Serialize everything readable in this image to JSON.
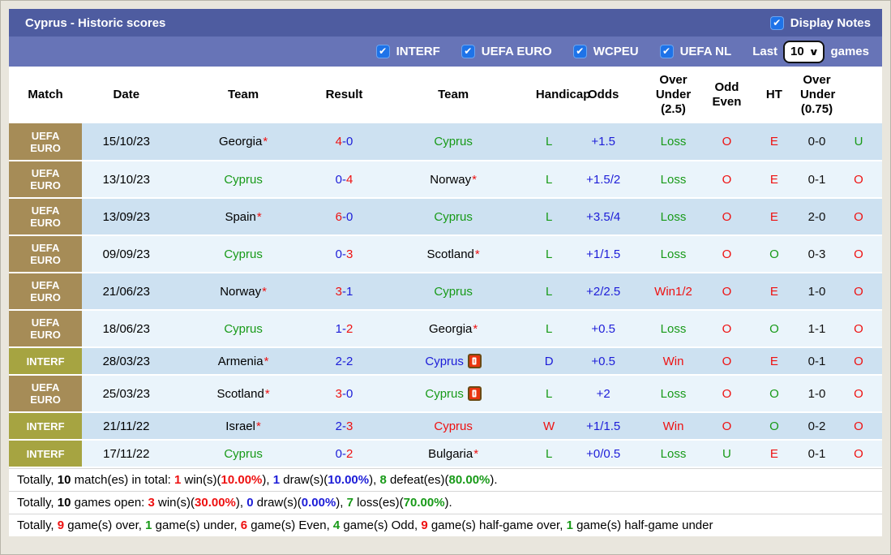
{
  "header": {
    "title": "Cyprus - Historic scores",
    "display_notes_label": "Display Notes"
  },
  "icons": {
    "check": "✔",
    "chevron_down": "∨"
  },
  "colors": {
    "title_bar": "#4e5ca0",
    "filter_bar": "#6774b7",
    "checkbox_blue": "#1e73e8",
    "euro_label_bg": "#a68c57",
    "interf_label_bg": "#a6a441",
    "row_dark": "#cde1f1",
    "row_light": "#eaf4fb",
    "win_red": "#ee1111",
    "draw_blue": "#1d1dd8",
    "loss_green": "#189a18"
  },
  "filters": {
    "competitions": [
      "INTERF",
      "UEFA EURO",
      "WCPEU",
      "UEFA NL"
    ],
    "last_label": "Last",
    "last_value": "10",
    "games_label": "games"
  },
  "table": {
    "columns": [
      "Match",
      "Date",
      "Team",
      "Result",
      "Team",
      "Handicap",
      "Odds",
      "Over Under (2.5)",
      "Odd Even",
      "HT",
      "Over Under (0.75)"
    ],
    "rows": [
      {
        "comp": {
          "label": "UEFA EURO",
          "class": "euro"
        },
        "date": "15/10/23",
        "home": {
          "name": "Georgia",
          "color": "black",
          "star": true,
          "redcard": false
        },
        "score": {
          "home": "4",
          "home_color": "red",
          "away": "0",
          "away_color": "blue"
        },
        "away": {
          "name": "Cyprus",
          "color": "green",
          "star": false,
          "redcard": false
        },
        "wdl": {
          "text": "L",
          "color": "green"
        },
        "handicap": "+1.5",
        "odds": {
          "text": "Loss",
          "color": "green"
        },
        "over_under_25": {
          "text": "O",
          "color": "red"
        },
        "odd_even": {
          "text": "E",
          "color": "red"
        },
        "ht": "0-0",
        "over_under_075": {
          "text": "U",
          "color": "green"
        }
      },
      {
        "comp": {
          "label": "UEFA EURO",
          "class": "euro"
        },
        "date": "13/10/23",
        "home": {
          "name": "Cyprus",
          "color": "green",
          "star": false,
          "redcard": false
        },
        "score": {
          "home": "0",
          "home_color": "blue",
          "away": "4",
          "away_color": "red"
        },
        "away": {
          "name": "Norway",
          "color": "black",
          "star": true,
          "redcard": false
        },
        "wdl": {
          "text": "L",
          "color": "green"
        },
        "handicap": "+1.5/2",
        "odds": {
          "text": "Loss",
          "color": "green"
        },
        "over_under_25": {
          "text": "O",
          "color": "red"
        },
        "odd_even": {
          "text": "E",
          "color": "red"
        },
        "ht": "0-1",
        "over_under_075": {
          "text": "O",
          "color": "red"
        }
      },
      {
        "comp": {
          "label": "UEFA EURO",
          "class": "euro"
        },
        "date": "13/09/23",
        "home": {
          "name": "Spain",
          "color": "black",
          "star": true,
          "redcard": false
        },
        "score": {
          "home": "6",
          "home_color": "red",
          "away": "0",
          "away_color": "blue"
        },
        "away": {
          "name": "Cyprus",
          "color": "green",
          "star": false,
          "redcard": false
        },
        "wdl": {
          "text": "L",
          "color": "green"
        },
        "handicap": "+3.5/4",
        "odds": {
          "text": "Loss",
          "color": "green"
        },
        "over_under_25": {
          "text": "O",
          "color": "red"
        },
        "odd_even": {
          "text": "E",
          "color": "red"
        },
        "ht": "2-0",
        "over_under_075": {
          "text": "O",
          "color": "red"
        }
      },
      {
        "comp": {
          "label": "UEFA EURO",
          "class": "euro"
        },
        "date": "09/09/23",
        "home": {
          "name": "Cyprus",
          "color": "green",
          "star": false,
          "redcard": false
        },
        "score": {
          "home": "0",
          "home_color": "blue",
          "away": "3",
          "away_color": "red"
        },
        "away": {
          "name": "Scotland",
          "color": "black",
          "star": true,
          "redcard": false
        },
        "wdl": {
          "text": "L",
          "color": "green"
        },
        "handicap": "+1/1.5",
        "odds": {
          "text": "Loss",
          "color": "green"
        },
        "over_under_25": {
          "text": "O",
          "color": "red"
        },
        "odd_even": {
          "text": "O",
          "color": "green"
        },
        "ht": "0-3",
        "over_under_075": {
          "text": "O",
          "color": "red"
        }
      },
      {
        "comp": {
          "label": "UEFA EURO",
          "class": "euro"
        },
        "date": "21/06/23",
        "home": {
          "name": "Norway",
          "color": "black",
          "star": true,
          "redcard": false
        },
        "score": {
          "home": "3",
          "home_color": "red",
          "away": "1",
          "away_color": "blue"
        },
        "away": {
          "name": "Cyprus",
          "color": "green",
          "star": false,
          "redcard": false
        },
        "wdl": {
          "text": "L",
          "color": "green"
        },
        "handicap": "+2/2.5",
        "odds": {
          "text": "Win1/2",
          "color": "red"
        },
        "over_under_25": {
          "text": "O",
          "color": "red"
        },
        "odd_even": {
          "text": "E",
          "color": "red"
        },
        "ht": "1-0",
        "over_under_075": {
          "text": "O",
          "color": "red"
        }
      },
      {
        "comp": {
          "label": "UEFA EURO",
          "class": "euro"
        },
        "date": "18/06/23",
        "home": {
          "name": "Cyprus",
          "color": "green",
          "star": false,
          "redcard": false
        },
        "score": {
          "home": "1",
          "home_color": "blue",
          "away": "2",
          "away_color": "red"
        },
        "away": {
          "name": "Georgia",
          "color": "black",
          "star": true,
          "redcard": false
        },
        "wdl": {
          "text": "L",
          "color": "green"
        },
        "handicap": "+0.5",
        "odds": {
          "text": "Loss",
          "color": "green"
        },
        "over_under_25": {
          "text": "O",
          "color": "red"
        },
        "odd_even": {
          "text": "O",
          "color": "green"
        },
        "ht": "1-1",
        "over_under_075": {
          "text": "O",
          "color": "red"
        }
      },
      {
        "comp": {
          "label": "INTERF",
          "class": "interf"
        },
        "date": "28/03/23",
        "home": {
          "name": "Armenia",
          "color": "black",
          "star": true,
          "redcard": false
        },
        "score": {
          "home": "2",
          "home_color": "blue",
          "away": "2",
          "away_color": "blue"
        },
        "away": {
          "name": "Cyprus",
          "color": "blue",
          "star": false,
          "redcard": true
        },
        "wdl": {
          "text": "D",
          "color": "blue"
        },
        "handicap": "+0.5",
        "odds": {
          "text": "Win",
          "color": "red"
        },
        "over_under_25": {
          "text": "O",
          "color": "red"
        },
        "odd_even": {
          "text": "E",
          "color": "red"
        },
        "ht": "0-1",
        "over_under_075": {
          "text": "O",
          "color": "red"
        }
      },
      {
        "comp": {
          "label": "UEFA EURO",
          "class": "euro"
        },
        "date": "25/03/23",
        "home": {
          "name": "Scotland",
          "color": "black",
          "star": true,
          "redcard": false
        },
        "score": {
          "home": "3",
          "home_color": "red",
          "away": "0",
          "away_color": "blue"
        },
        "away": {
          "name": "Cyprus",
          "color": "green",
          "star": false,
          "redcard": true
        },
        "wdl": {
          "text": "L",
          "color": "green"
        },
        "handicap": "+2",
        "odds": {
          "text": "Loss",
          "color": "green"
        },
        "over_under_25": {
          "text": "O",
          "color": "red"
        },
        "odd_even": {
          "text": "O",
          "color": "green"
        },
        "ht": "1-0",
        "over_under_075": {
          "text": "O",
          "color": "red"
        }
      },
      {
        "comp": {
          "label": "INTERF",
          "class": "interf"
        },
        "date": "21/11/22",
        "home": {
          "name": "Israel",
          "color": "black",
          "star": true,
          "redcard": false
        },
        "score": {
          "home": "2",
          "home_color": "blue",
          "away": "3",
          "away_color": "red"
        },
        "away": {
          "name": "Cyprus",
          "color": "red",
          "star": false,
          "redcard": false
        },
        "wdl": {
          "text": "W",
          "color": "red"
        },
        "handicap": "+1/1.5",
        "odds": {
          "text": "Win",
          "color": "red"
        },
        "over_under_25": {
          "text": "O",
          "color": "red"
        },
        "odd_even": {
          "text": "O",
          "color": "green"
        },
        "ht": "0-2",
        "over_under_075": {
          "text": "O",
          "color": "red"
        }
      },
      {
        "comp": {
          "label": "INTERF",
          "class": "interf"
        },
        "date": "17/11/22",
        "home": {
          "name": "Cyprus",
          "color": "green",
          "star": false,
          "redcard": false
        },
        "score": {
          "home": "0",
          "home_color": "blue",
          "away": "2",
          "away_color": "red"
        },
        "away": {
          "name": "Bulgaria",
          "color": "black",
          "star": true,
          "redcard": false
        },
        "wdl": {
          "text": "L",
          "color": "green"
        },
        "handicap": "+0/0.5",
        "odds": {
          "text": "Loss",
          "color": "green"
        },
        "over_under_25": {
          "text": "U",
          "color": "green"
        },
        "odd_even": {
          "text": "E",
          "color": "red"
        },
        "ht": "0-1",
        "over_under_075": {
          "text": "O",
          "color": "red"
        }
      }
    ]
  },
  "summary": [
    [
      {
        "text": "Totally, ",
        "style": "plain"
      },
      {
        "text": "10",
        "style": "bold"
      },
      {
        "text": " match(es) in total: ",
        "style": "plain"
      },
      {
        "text": "1",
        "style": "red"
      },
      {
        "text": " win(s)(",
        "style": "plain"
      },
      {
        "text": "10.00%",
        "style": "red"
      },
      {
        "text": "), ",
        "style": "plain"
      },
      {
        "text": "1",
        "style": "blue"
      },
      {
        "text": " draw(s)(",
        "style": "plain"
      },
      {
        "text": "10.00%",
        "style": "blue"
      },
      {
        "text": "), ",
        "style": "plain"
      },
      {
        "text": "8",
        "style": "green"
      },
      {
        "text": " defeat(es)(",
        "style": "plain"
      },
      {
        "text": "80.00%",
        "style": "green"
      },
      {
        "text": ").",
        "style": "plain"
      }
    ],
    [
      {
        "text": "Totally, ",
        "style": "plain"
      },
      {
        "text": "10",
        "style": "bold"
      },
      {
        "text": " games open: ",
        "style": "plain"
      },
      {
        "text": "3",
        "style": "red"
      },
      {
        "text": " win(s)(",
        "style": "plain"
      },
      {
        "text": "30.00%",
        "style": "red"
      },
      {
        "text": "), ",
        "style": "plain"
      },
      {
        "text": "0",
        "style": "blue"
      },
      {
        "text": " draw(s)(",
        "style": "plain"
      },
      {
        "text": "0.00%",
        "style": "blue"
      },
      {
        "text": "), ",
        "style": "plain"
      },
      {
        "text": "7",
        "style": "green"
      },
      {
        "text": " loss(es)(",
        "style": "plain"
      },
      {
        "text": "70.00%",
        "style": "green"
      },
      {
        "text": ").",
        "style": "plain"
      }
    ],
    [
      {
        "text": "Totally, ",
        "style": "plain"
      },
      {
        "text": "9",
        "style": "red"
      },
      {
        "text": " game(s) over, ",
        "style": "plain"
      },
      {
        "text": "1",
        "style": "green"
      },
      {
        "text": " game(s) under, ",
        "style": "plain"
      },
      {
        "text": "6",
        "style": "red"
      },
      {
        "text": " game(s) Even, ",
        "style": "plain"
      },
      {
        "text": "4",
        "style": "green"
      },
      {
        "text": " game(s) Odd, ",
        "style": "plain"
      },
      {
        "text": "9",
        "style": "red"
      },
      {
        "text": " game(s) half-game over, ",
        "style": "plain"
      },
      {
        "text": "1",
        "style": "green"
      },
      {
        "text": " game(s) half-game under",
        "style": "plain"
      }
    ]
  ]
}
